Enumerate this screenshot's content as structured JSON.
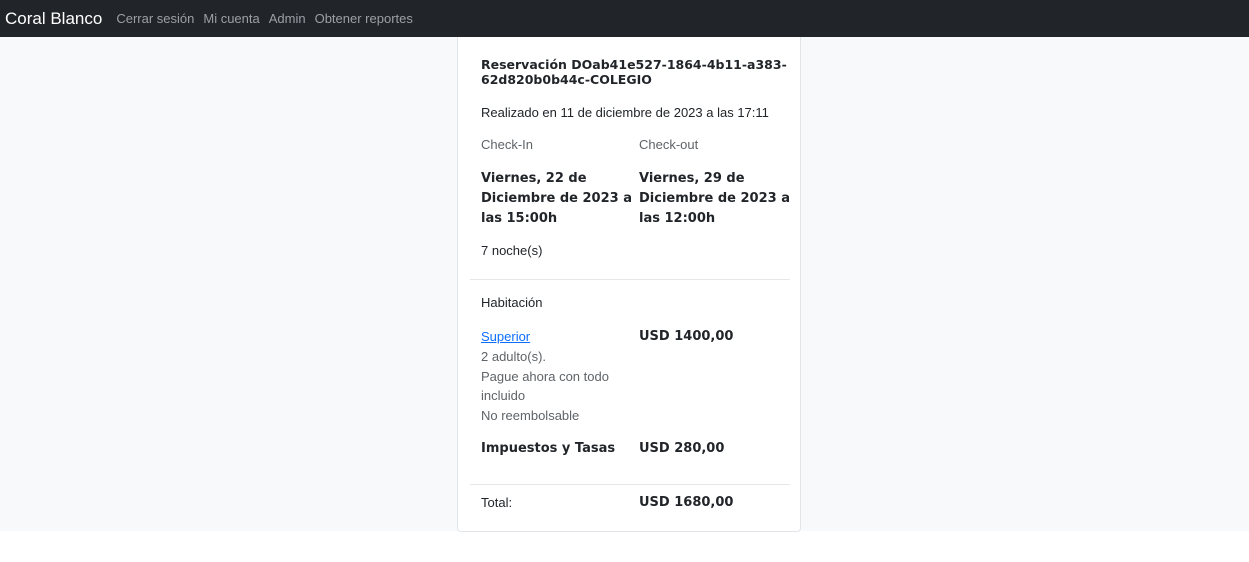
{
  "navbar": {
    "brand": "Coral Blanco",
    "links": [
      "Cerrar sesión",
      "Mi cuenta",
      "Admin",
      "Obtener reportes"
    ]
  },
  "reservation": {
    "title_line1": "Reservación DOab41e527-1864-4b11-a383-",
    "title_line2": "62d820b0b44c-COLEGIO",
    "created": "Realizado en 11 de diciembre de 2023 a las 17:11",
    "checkin_label": "Check-In",
    "checkout_label": "Check-out",
    "checkin_lines": [
      "Viernes, 22 de",
      "Diciembre de 2023 a",
      "las 15:00h"
    ],
    "checkout_lines": [
      "Viernes, 29 de",
      "Diciembre de 2023 a",
      "las 12:00h"
    ],
    "nights": "7 noche(s)"
  },
  "room": {
    "section_label": "Habitación",
    "name": "Superior",
    "details": [
      "2 adulto(s).",
      "Pague ahora con todo",
      "incluido",
      "No reembolsable"
    ],
    "price": "USD 1400,00"
  },
  "taxes": {
    "label": "Impuestos y Tasas",
    "amount": "USD 280,00"
  },
  "total": {
    "label": "Total:",
    "amount": "USD 1680,00"
  },
  "colors": {
    "navbar": "#212529",
    "link": "#0d6efd",
    "page_background": "#f8f9fa"
  }
}
